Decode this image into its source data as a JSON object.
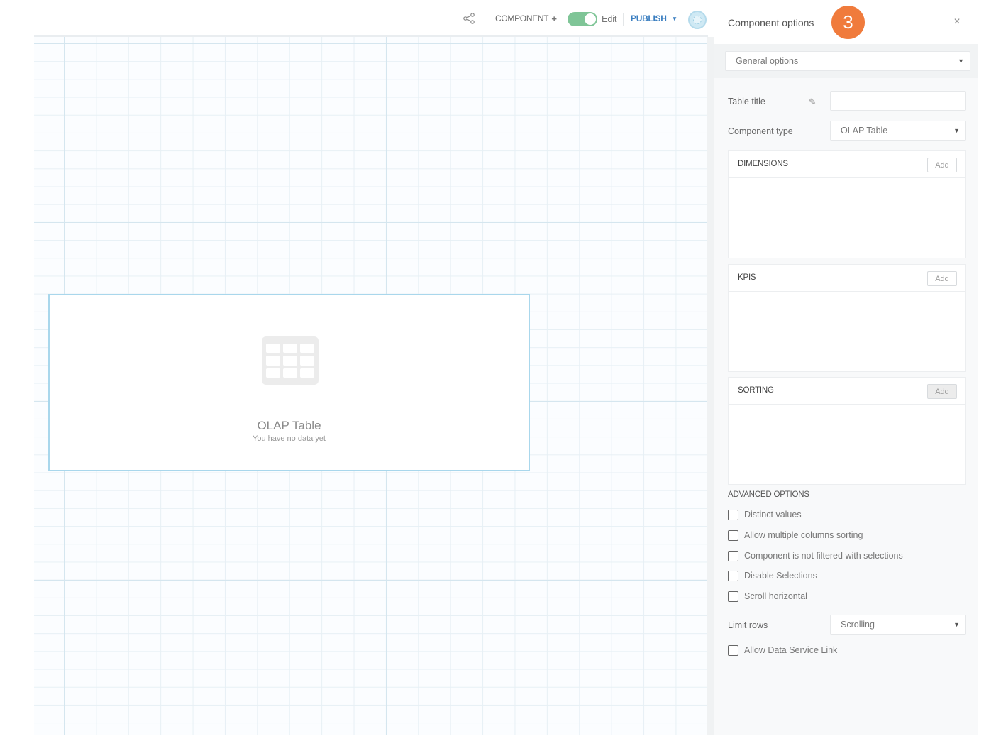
{
  "toolbar": {
    "component_label": "COMPONENT",
    "component_plus": "+",
    "edit_label": "Edit",
    "edit_toggle_on": true,
    "publish_label": "PUBLISH",
    "publish_caret": "▾",
    "share_icon": "share-icon",
    "accent_color": "#3a7ec0",
    "toggle_color": "#7fc597"
  },
  "canvas": {
    "component": {
      "title": "OLAP Table",
      "subtitle": "You have no data yet",
      "icon": "table-grid-icon"
    }
  },
  "panel": {
    "title": "Component options",
    "badge": "3",
    "badge_color": "#f07b3c",
    "close": "×",
    "section_select": "General options",
    "table_title_label": "Table title",
    "table_title_value": "",
    "component_type_label": "Component type",
    "component_type_value": "OLAP Table",
    "dimensions": {
      "title": "DIMENSIONS",
      "add": "Add"
    },
    "kpis": {
      "title": "KPIS",
      "add": "Add"
    },
    "sorting": {
      "title": "SORTING",
      "add": "Add"
    },
    "advanced_title": "ADVANCED OPTIONS",
    "advanced_options": [
      {
        "label": "Distinct values",
        "checked": false
      },
      {
        "label": "Allow multiple columns sorting",
        "checked": false
      },
      {
        "label": "Component is not filtered with selections",
        "checked": false
      },
      {
        "label": "Disable Selections",
        "checked": false
      },
      {
        "label": "Scroll horizontal",
        "checked": false
      }
    ],
    "limit_rows_label": "Limit rows",
    "limit_rows_value": "Scrolling",
    "data_service_link": {
      "label": "Allow Data Service Link",
      "checked": false
    }
  }
}
